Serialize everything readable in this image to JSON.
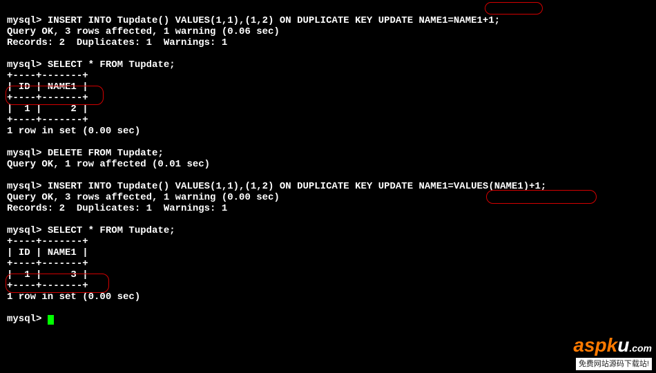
{
  "lines": {
    "l1_prompt": "mysql> ",
    "l1_sql": "INSERT INTO Tupdate() VALUES(1,1),(1,2) ON DUPLICATE KEY UPDATE NAME1=NAME1+1;",
    "l2": "Query OK, 3 rows affected, 1 warning (0.06 sec)",
    "l3": "Records: 2  Duplicates: 1  Warnings: 1",
    "l4": "",
    "l5_prompt": "mysql> ",
    "l5_sql": "SELECT * FROM Tupdate;",
    "t1_sep": "+----+-------+",
    "t1_head": "| ID | NAME1 |",
    "t1_row": "|  1 |     2 |",
    "l10": "1 row in set (0.00 sec)",
    "l11": "",
    "l12_prompt": "mysql> ",
    "l12_sql": "DELETE FROM Tupdate;",
    "l13": "Query OK, 1 row affected (0.01 sec)",
    "l14": "",
    "l15_prompt": "mysql> ",
    "l15_sql": "INSERT INTO Tupdate() VALUES(1,1),(1,2) ON DUPLICATE KEY UPDATE NAME1=VALUES(NAME1)+1;",
    "l16": "Query OK, 3 rows affected, 1 warning (0.00 sec)",
    "l17": "Records: 2  Duplicates: 1  Warnings: 1",
    "l18": "",
    "l19_prompt": "mysql> ",
    "l19_sql": "SELECT * FROM Tupdate;",
    "t2_sep": "+----+-------+",
    "t2_head": "| ID | NAME1 |",
    "t2_row": "|  1 |     3 |",
    "l24": "1 row in set (0.00 sec)",
    "l25": "",
    "l26_prompt": "mysql> "
  },
  "chart_data": {
    "type": "table",
    "tables": [
      {
        "title": "Tupdate after UPDATE NAME1=NAME1+1",
        "columns": [
          "ID",
          "NAME1"
        ],
        "rows": [
          [
            1,
            2
          ]
        ]
      },
      {
        "title": "Tupdate after UPDATE NAME1=VALUES(NAME1)+1",
        "columns": [
          "ID",
          "NAME1"
        ],
        "rows": [
          [
            1,
            3
          ]
        ]
      }
    ]
  },
  "watermark": {
    "brand_orange": "aspk",
    "brand_white": "u",
    "brand_dom": ".com",
    "tagline": "免费网站源码下载站!"
  }
}
